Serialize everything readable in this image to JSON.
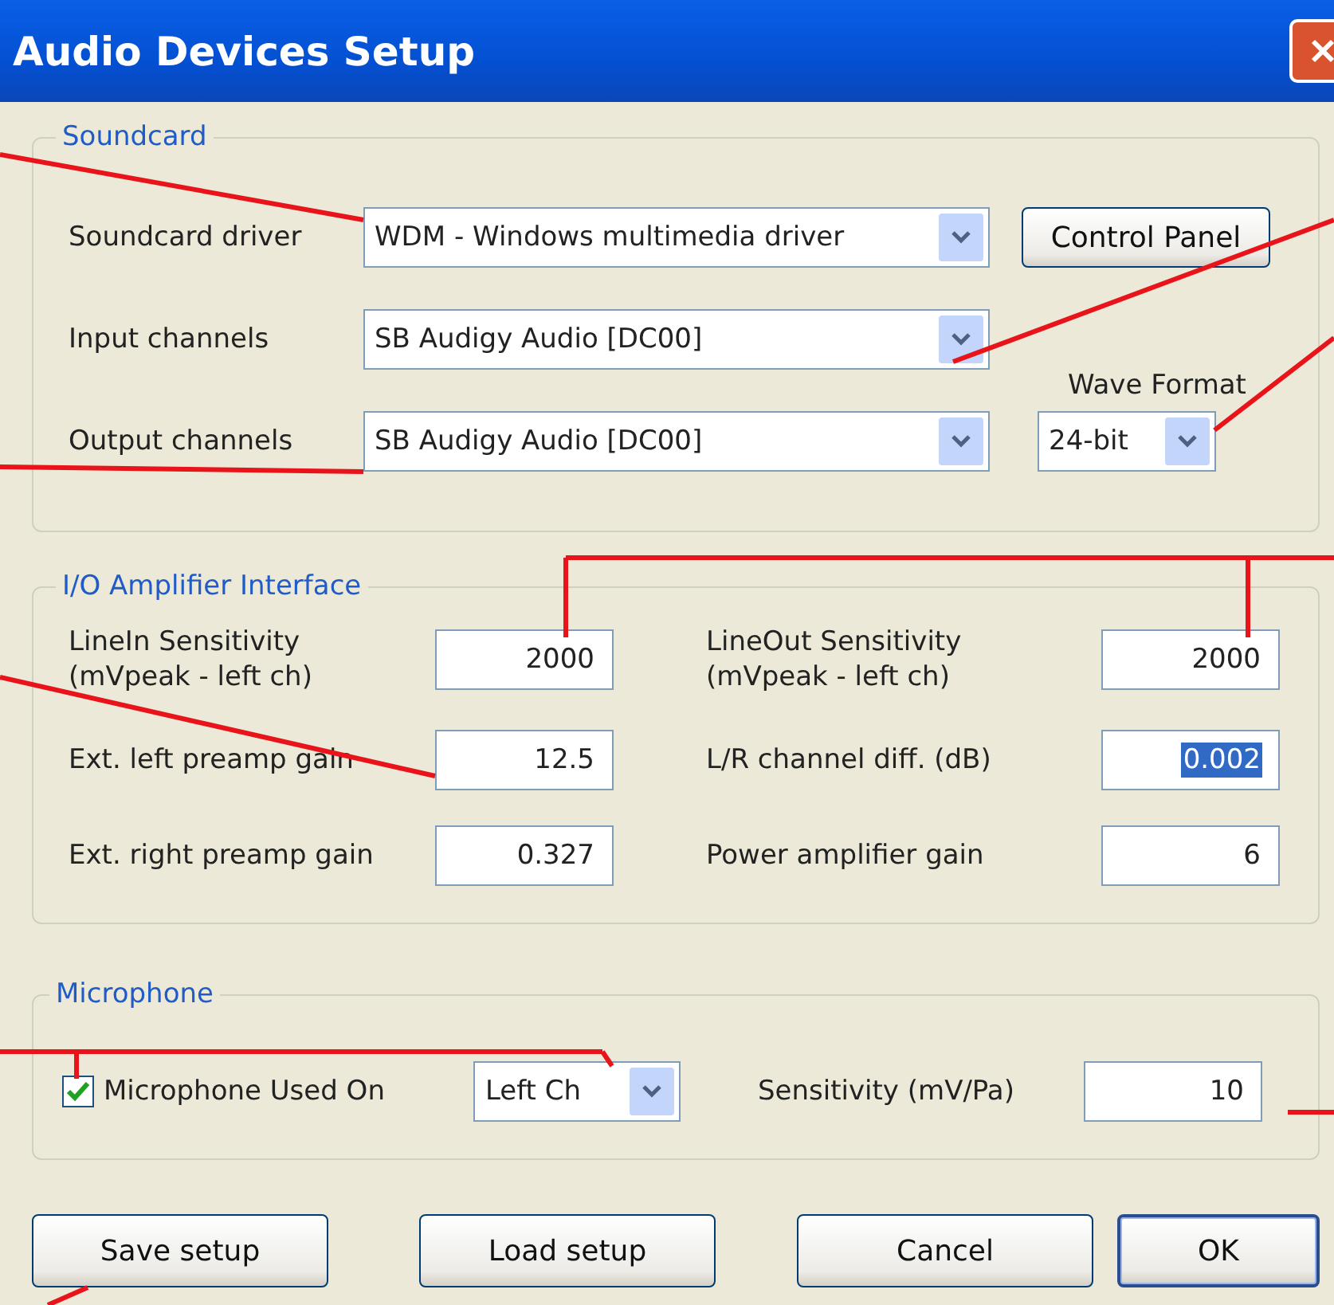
{
  "window": {
    "title": "Audio Devices Setup"
  },
  "soundcard": {
    "title": "Soundcard",
    "rows": [
      {
        "label": "Soundcard driver",
        "value": "WDM - Windows multimedia driver"
      },
      {
        "label": "Input channels",
        "value": "SB Audigy Audio [DC00]"
      },
      {
        "label": "Output channels",
        "value": "SB Audigy Audio [DC00]"
      }
    ],
    "control_panel_button": "Control Panel",
    "wave_format": {
      "label": "Wave Format",
      "value": "24-bit"
    }
  },
  "io_amplifier": {
    "title": "I/O Amplifier Interface",
    "fields": [
      {
        "label": "LineIn Sensitivity\n(mVpeak - left ch)",
        "value": "2000",
        "selected": false
      },
      {
        "label": "LineOut Sensitivity\n(mVpeak - left ch)",
        "value": "2000",
        "selected": false
      },
      {
        "label": "Ext. left preamp gain",
        "value": "12.5",
        "selected": false
      },
      {
        "label": "L/R channel diff. (dB)",
        "value": "0.002",
        "selected": true
      },
      {
        "label": "Ext. right preamp gain",
        "value": "0.327",
        "selected": false
      },
      {
        "label": "Power amplifier gain",
        "value": "6",
        "selected": false
      }
    ]
  },
  "microphone": {
    "title": "Microphone",
    "used_on": {
      "label": "Microphone Used On",
      "checked": true
    },
    "channel": "Left Ch",
    "sensitivity": {
      "label": "Sensitivity (mV/Pa)",
      "value": "10"
    }
  },
  "buttons": [
    {
      "label": "Save setup",
      "default": false
    },
    {
      "label": "Load setup",
      "default": false
    },
    {
      "label": "Cancel",
      "default": false
    },
    {
      "label": "OK",
      "default": true
    }
  ]
}
